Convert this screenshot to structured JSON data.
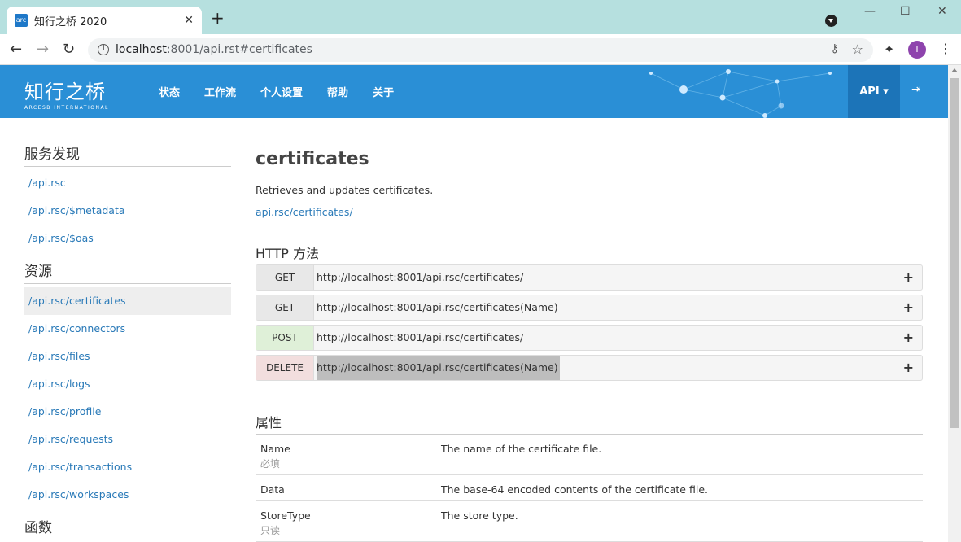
{
  "browser": {
    "tab_title": "知行之桥 2020",
    "favicon_text": "arc",
    "url_host": "localhost",
    "url_rest": ":8001/api.rst#certificates",
    "avatar_letter": "I"
  },
  "nav": {
    "logo_main": "知行之桥",
    "logo_sub": "ARCESB INTERNATIONAL",
    "links": [
      "状态",
      "工作流",
      "个人设置",
      "帮助",
      "关于"
    ],
    "api_label": "API ▾"
  },
  "sidebar": {
    "sections": [
      {
        "heading": "服务发现",
        "items": [
          "/api.rsc",
          "/api.rsc/$metadata",
          "/api.rsc/$oas"
        ]
      },
      {
        "heading": "资源",
        "items": [
          "/api.rsc/certificates",
          "/api.rsc/connectors",
          "/api.rsc/files",
          "/api.rsc/logs",
          "/api.rsc/profile",
          "/api.rsc/requests",
          "/api.rsc/transactions",
          "/api.rsc/workspaces"
        ]
      },
      {
        "heading": "函数",
        "items": []
      }
    ],
    "active_item": "/api.rsc/certificates"
  },
  "main": {
    "title": "certificates",
    "description": "Retrieves and updates certificates.",
    "resource_link": "api.rsc/certificates/",
    "http_heading": "HTTP 方法",
    "methods": [
      {
        "verb": "GET",
        "path": "http://localhost:8001/api.rsc/certificates/"
      },
      {
        "verb": "GET",
        "path": "http://localhost:8001/api.rsc/certificates(Name)"
      },
      {
        "verb": "POST",
        "path": "http://localhost:8001/api.rsc/certificates/"
      },
      {
        "verb": "DELETE",
        "path": "http://localhost:8001/api.rsc/certificates(Name)"
      }
    ],
    "properties_heading": "属性",
    "properties": [
      {
        "name": "Name",
        "attr": "必填",
        "description": "The name of the certificate file."
      },
      {
        "name": "Data",
        "attr": "",
        "description": "The base-64 encoded contents of the certificate file."
      },
      {
        "name": "StoreType",
        "attr": "只读",
        "description": "The store type."
      }
    ]
  }
}
